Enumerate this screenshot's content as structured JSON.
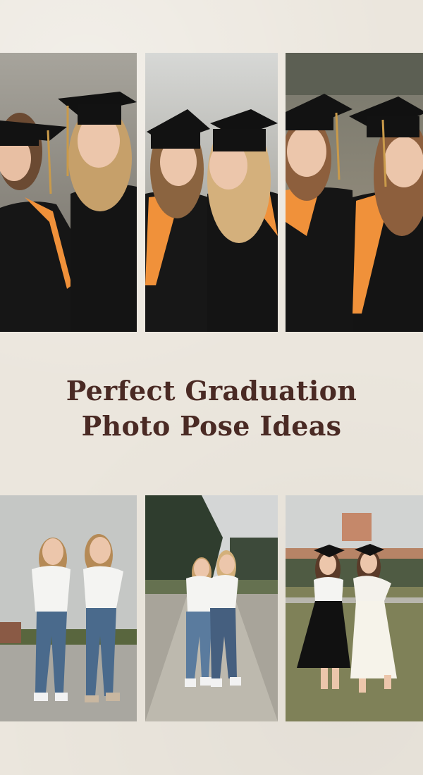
{
  "pin": {
    "title_line1": "Perfect Graduation",
    "title_line2": "Photo Pose Ideas",
    "colors": {
      "background": "#ebe6dd",
      "title": "#4a2a24",
      "gown": "#141414",
      "stole": "#f0913a"
    }
  },
  "photos": [
    {
      "subject": "two graduates in black caps and gowns with orange stoles, close up"
    },
    {
      "subject": "two graduates in caps and gowns leaning together"
    },
    {
      "subject": "two graduates in caps and gowns with tassels"
    },
    {
      "subject": "two women in white tops and jeans posing on a path"
    },
    {
      "subject": "two women in white tops and jeans walking on a tree-lined road"
    },
    {
      "subject": "two graduates in caps with skirts posing on a campus lawn"
    }
  ]
}
